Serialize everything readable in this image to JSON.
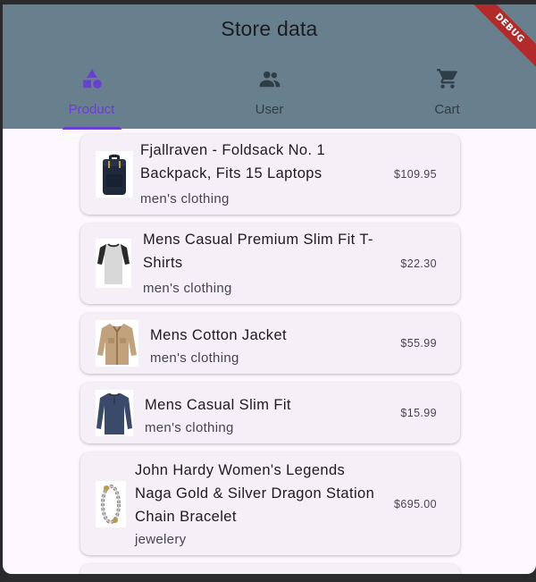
{
  "appbar": {
    "title": "Store data",
    "debug_banner": "DEBUG"
  },
  "tabs": [
    {
      "label": "Product",
      "icon": "category-shapes-icon",
      "active": true
    },
    {
      "label": "User",
      "icon": "people-icon",
      "active": false
    },
    {
      "label": "Cart",
      "icon": "shopping-cart-icon",
      "active": false
    }
  ],
  "products": [
    {
      "name": "Fjallraven - Foldsack No. 1 Backpack, Fits 15 Laptops",
      "category": "men's clothing",
      "price": "$109.95",
      "image": "backpack"
    },
    {
      "name": "Mens Casual Premium Slim Fit T-Shirts",
      "category": "men's clothing",
      "price": "$22.30",
      "image": "tshirt"
    },
    {
      "name": "Mens Cotton Jacket",
      "category": "men's clothing",
      "price": "$55.99",
      "image": "jacket"
    },
    {
      "name": "Mens Casual Slim Fit",
      "category": "men's clothing",
      "price": "$15.99",
      "image": "longsleeve"
    },
    {
      "name": "John Hardy Women's Legends Naga Gold & Silver Dragon Station Chain Bracelet",
      "category": "jewelery",
      "price": "$695.00",
      "image": "bracelet"
    }
  ],
  "colors": {
    "appbar": "#687f8e",
    "accent": "#6a3fd1",
    "card": "#f5eff8",
    "background": "#fdf7fe"
  }
}
